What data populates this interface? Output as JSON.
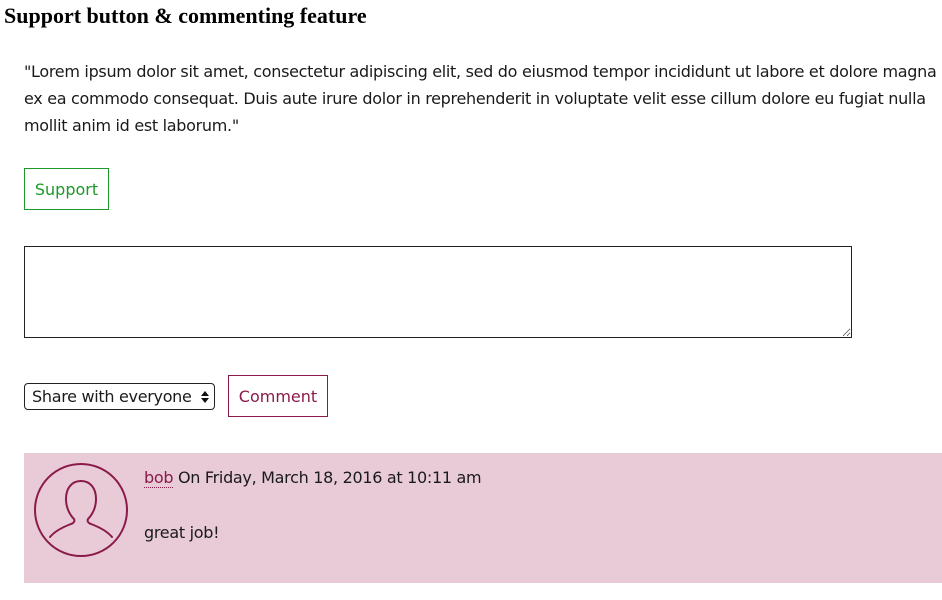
{
  "header": {
    "title": "Support button & commenting feature"
  },
  "intro": {
    "line1": "\"Lorem ipsum dolor sit amet, consectetur adipiscing elit, sed do eiusmod tempor incididunt ut labore et dolore magna",
    "line2": "ex ea commodo consequat. Duis aute irure dolor in reprehenderit in voluptate velit esse cillum dolore eu fugiat nulla",
    "line3": "mollit anim id est laborum.\""
  },
  "support": {
    "label": "Support",
    "color": "#1a9a2a"
  },
  "comment_form": {
    "textarea_value": "",
    "share_select": {
      "selected": "Share with everyone",
      "icon": "updown-arrows-icon"
    },
    "submit_label": "Comment",
    "accent_color": "#8a1a4a"
  },
  "comments": [
    {
      "author": "bob",
      "timestamp": " On Friday, March 18, 2016 at 10:11 am",
      "text": "great job!",
      "avatar_icon": "user-silhouette-icon",
      "background": "#e8cbd6"
    }
  ]
}
